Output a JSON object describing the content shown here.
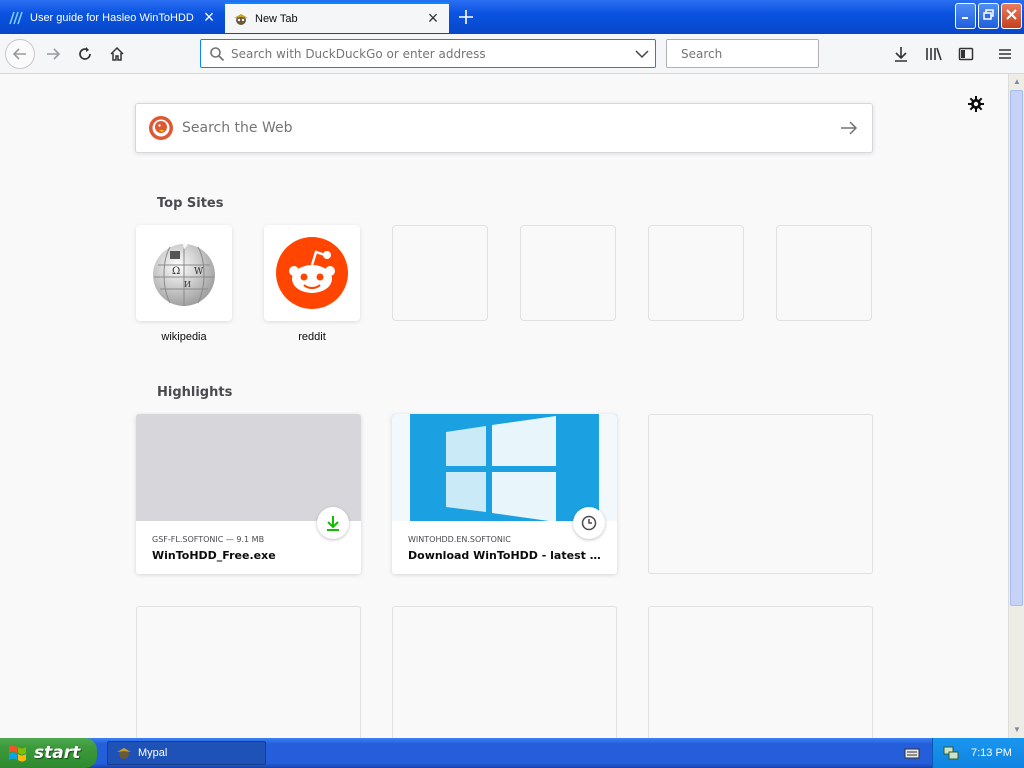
{
  "tabs": [
    {
      "title": "User guide for Hasleo WinToHDD",
      "icon": "hasleo-favicon",
      "active": false
    },
    {
      "title": "New Tab",
      "icon": "mypal-favicon",
      "active": true
    }
  ],
  "navbar": {
    "url_placeholder": "Search with DuckDuckGo or enter address",
    "search_placeholder": "Search"
  },
  "newtab": {
    "search_placeholder": "Search the Web",
    "top_sites_heading": "Top Sites",
    "highlights_heading": "Highlights",
    "top_sites": [
      {
        "label": "wikipedia",
        "icon": "wikipedia-globe-icon"
      },
      {
        "label": "reddit",
        "icon": "reddit-alien-icon"
      }
    ],
    "highlights": [
      {
        "domain": "GSF-FL.SOFTONIC — 9.1 MB",
        "title": "WinToHDD_Free.exe",
        "badge": "download-icon"
      },
      {
        "domain": "WINTOHDD.EN.SOFTONIC",
        "title": "Download WinToHDD - latest ve...",
        "badge": "clock-icon"
      }
    ]
  },
  "taskbar": {
    "start_label": "start",
    "task_label": "Mypal",
    "clock": "7:13 PM"
  },
  "colors": {
    "accent": "#0a84ff",
    "reddit": "#ff4500",
    "download": "#12bc00",
    "win_tile": "#1ba1e2"
  }
}
